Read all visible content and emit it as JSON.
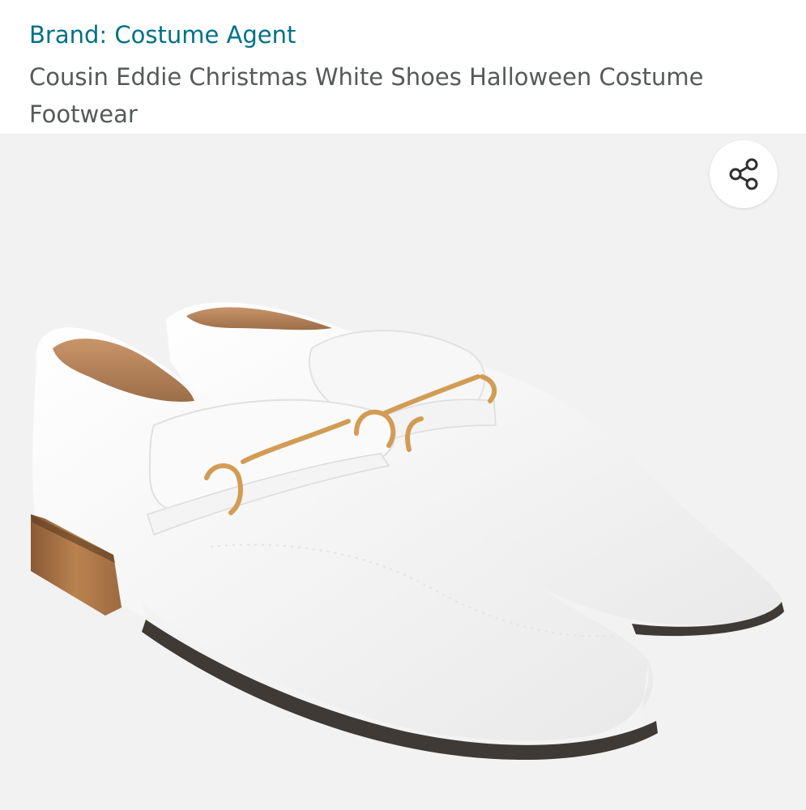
{
  "product": {
    "brand_label": "Brand: Costume Agent",
    "title": "Cousin Eddie Christmas White Shoes Halloween Costume Footwear"
  },
  "gallery": {
    "share_icon": "share-icon",
    "image": "white-loafers-with-gold-chain-photo"
  },
  "colors": {
    "brand_link": "#007185",
    "title_text": "#565959",
    "gallery_bg": "#f2f2f2",
    "shoe_white": "#fbfbfb",
    "heel_wood": "#a8734a",
    "chain_gold": "#d4a25a",
    "lining_tan": "#b7845a"
  }
}
